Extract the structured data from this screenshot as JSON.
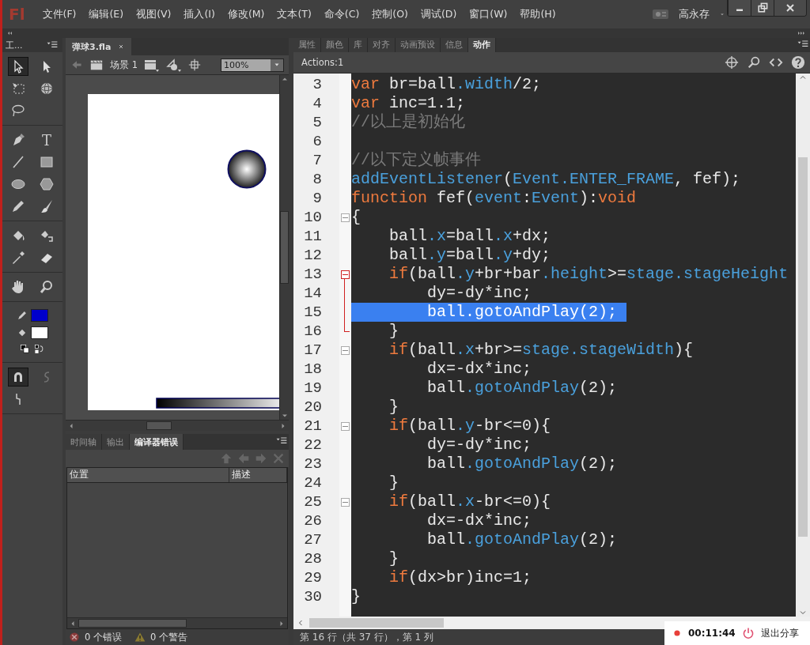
{
  "menu_bar": {
    "logo": "Fl",
    "menus": [
      "文件(F)",
      "编辑(E)",
      "视图(V)",
      "插入(I)",
      "修改(M)",
      "文本(T)",
      "命令(C)",
      "控制(O)",
      "调试(D)",
      "窗口(W)",
      "帮助(H)"
    ],
    "user": "高永存"
  },
  "tools_panel": {
    "title": "工...",
    "tool_groups": [
      {
        "tools": [
          {
            "selected": true
          },
          {
            "selected": false
          },
          {
            "selected": false
          },
          {
            "selected": false
          },
          {
            "selected": false
          }
        ]
      },
      {
        "tools": [
          {
            "selected": false
          },
          {
            "selected": false,
            "label": "T"
          },
          {
            "selected": false
          },
          {
            "selected": false
          },
          {
            "selected": false
          },
          {
            "selected": false
          },
          {
            "selected": false
          },
          {
            "selected": false
          }
        ]
      },
      {
        "tools": [
          {
            "selected": false
          },
          {
            "selected": false
          },
          {
            "selected": false
          },
          {
            "selected": false
          }
        ]
      },
      {
        "tools": [
          {
            "selected": false
          },
          {
            "selected": false
          }
        ]
      }
    ],
    "swatches": [
      {
        "color": "#0000cc"
      },
      {
        "color": "#ffffff"
      }
    ],
    "options": [
      {
        "selected": true,
        "disabled": false
      },
      {
        "selected": false,
        "disabled": true
      },
      {
        "selected": false,
        "disabled": false
      }
    ]
  },
  "document": {
    "tab": "弹球3.fla",
    "scene": "场景 1",
    "zoom": "100%"
  },
  "output_panel": {
    "tabs": [
      {
        "label": "时间轴",
        "selected": false
      },
      {
        "label": "输出",
        "selected": false
      },
      {
        "label": "编译器错误",
        "selected": true
      }
    ],
    "columns": [
      "位置",
      "描述"
    ],
    "errors": "0 个错误",
    "warnings": "0 个警告"
  },
  "actions_panel": {
    "tabs": [
      {
        "label": "属性",
        "selected": false
      },
      {
        "label": "颜色",
        "selected": false
      },
      {
        "label": "库",
        "selected": false
      },
      {
        "label": "对齐",
        "selected": false
      },
      {
        "label": "动画预设",
        "selected": false
      },
      {
        "label": "信息",
        "selected": false
      },
      {
        "label": "动作",
        "selected": true
      }
    ],
    "title": "Actions:1",
    "lines": [
      {
        "number": "3",
        "selected": false,
        "tokens": [
          {
            "kind": "kw",
            "text": "var"
          },
          {
            "kind": "plain",
            "text": " br=ball"
          },
          {
            "kind": "prop",
            "text": ".width"
          },
          {
            "kind": "plain",
            "text": "/2;"
          }
        ]
      },
      {
        "number": "4",
        "selected": false,
        "tokens": [
          {
            "kind": "kw",
            "text": "var"
          },
          {
            "kind": "plain",
            "text": " inc=1.1;"
          }
        ]
      },
      {
        "number": "5",
        "selected": false,
        "tokens": [
          {
            "kind": "comment",
            "text": "//以上是初始化"
          }
        ]
      },
      {
        "number": "6",
        "selected": false
      },
      {
        "number": "7",
        "selected": false,
        "tokens": [
          {
            "kind": "comment",
            "text": "//以下定义帧事件"
          }
        ]
      },
      {
        "number": "8",
        "selected": false,
        "tokens": [
          {
            "kind": "prop",
            "text": "addEventListener"
          },
          {
            "kind": "plain",
            "text": "("
          },
          {
            "kind": "prop",
            "text": "Event.ENTER_FRAME"
          },
          {
            "kind": "plain",
            "text": ", fef);"
          }
        ]
      },
      {
        "number": "9",
        "selected": false,
        "tokens": [
          {
            "kind": "kw",
            "text": "function"
          },
          {
            "kind": "plain",
            "text": " fef("
          },
          {
            "kind": "prop",
            "text": "event"
          },
          {
            "kind": "plain",
            "text": ":"
          },
          {
            "kind": "prop",
            "text": "Event"
          },
          {
            "kind": "plain",
            "text": "):"
          },
          {
            "kind": "kw",
            "text": "void"
          }
        ]
      },
      {
        "number": "10",
        "selected": false,
        "foldable": true,
        "tokens": [
          {
            "kind": "plain",
            "text": "{"
          }
        ]
      },
      {
        "number": "11",
        "selected": false,
        "tokens": [
          {
            "kind": "plain",
            "text": "    ball"
          },
          {
            "kind": "prop",
            "text": ".x"
          },
          {
            "kind": "plain",
            "text": "=ball"
          },
          {
            "kind": "prop",
            "text": ".x"
          },
          {
            "kind": "plain",
            "text": "+dx;"
          }
        ]
      },
      {
        "number": "12",
        "selected": false,
        "tokens": [
          {
            "kind": "plain",
            "text": "    ball"
          },
          {
            "kind": "prop",
            "text": ".y"
          },
          {
            "kind": "plain",
            "text": "=ball"
          },
          {
            "kind": "prop",
            "text": ".y"
          },
          {
            "kind": "plain",
            "text": "+dy;"
          }
        ]
      },
      {
        "number": "13",
        "selected": false,
        "foldable": true,
        "fold_highlight": true,
        "tokens": [
          {
            "kind": "kw",
            "text": "    if"
          },
          {
            "kind": "plain",
            "text": "(ball"
          },
          {
            "kind": "prop",
            "text": ".y"
          },
          {
            "kind": "plain",
            "text": "+br+bar"
          },
          {
            "kind": "prop",
            "text": ".height"
          },
          {
            "kind": "plain",
            "text": ">="
          },
          {
            "kind": "prop",
            "text": "stage.stageHeight"
          }
        ]
      },
      {
        "number": "14",
        "selected": false,
        "guide": true,
        "tokens": [
          {
            "kind": "plain",
            "text": "        dy=-dy*inc;"
          }
        ]
      },
      {
        "number": "15",
        "selected": true,
        "guide": true,
        "tokens": [
          {
            "kind": "plain",
            "text": "        ball.gotoAndPlay(2);"
          }
        ]
      },
      {
        "number": "16",
        "selected": false,
        "guide": true,
        "guide_end": true,
        "tokens": [
          {
            "kind": "plain",
            "text": "    }"
          }
        ]
      },
      {
        "number": "17",
        "selected": false,
        "foldable": true,
        "tokens": [
          {
            "kind": "kw",
            "text": "    if"
          },
          {
            "kind": "plain",
            "text": "(ball"
          },
          {
            "kind": "prop",
            "text": ".x"
          },
          {
            "kind": "plain",
            "text": "+br>="
          },
          {
            "kind": "prop",
            "text": "stage.stageWidth"
          },
          {
            "kind": "plain",
            "text": "){"
          }
        ]
      },
      {
        "number": "18",
        "selected": false,
        "tokens": [
          {
            "kind": "plain",
            "text": "        dx=-dx*inc;"
          }
        ]
      },
      {
        "number": "19",
        "selected": false,
        "tokens": [
          {
            "kind": "plain",
            "text": "        ball"
          },
          {
            "kind": "prop",
            "text": ".gotoAndPlay"
          },
          {
            "kind": "plain",
            "text": "(2);"
          }
        ]
      },
      {
        "number": "20",
        "selected": false,
        "tokens": [
          {
            "kind": "plain",
            "text": "    }"
          }
        ]
      },
      {
        "number": "21",
        "selected": false,
        "foldable": true,
        "tokens": [
          {
            "kind": "kw",
            "text": "    if"
          },
          {
            "kind": "plain",
            "text": "(ball"
          },
          {
            "kind": "prop",
            "text": ".y"
          },
          {
            "kind": "plain",
            "text": "-br<=0){"
          }
        ]
      },
      {
        "number": "22",
        "selected": false,
        "tokens": [
          {
            "kind": "plain",
            "text": "        dy=-dy*inc;"
          }
        ]
      },
      {
        "number": "23",
        "selected": false,
        "tokens": [
          {
            "kind": "plain",
            "text": "        ball"
          },
          {
            "kind": "prop",
            "text": ".gotoAndPlay"
          },
          {
            "kind": "plain",
            "text": "(2);"
          }
        ]
      },
      {
        "number": "24",
        "selected": false,
        "tokens": [
          {
            "kind": "plain",
            "text": "    }"
          }
        ]
      },
      {
        "number": "25",
        "selected": false,
        "foldable": true,
        "tokens": [
          {
            "kind": "kw",
            "text": "    if"
          },
          {
            "kind": "plain",
            "text": "(ball"
          },
          {
            "kind": "prop",
            "text": ".x"
          },
          {
            "kind": "plain",
            "text": "-br<=0){"
          }
        ]
      },
      {
        "number": "26",
        "selected": false,
        "tokens": [
          {
            "kind": "plain",
            "text": "        dx=-dx*inc;"
          }
        ]
      },
      {
        "number": "27",
        "selected": false,
        "tokens": [
          {
            "kind": "plain",
            "text": "        ball"
          },
          {
            "kind": "prop",
            "text": ".gotoAndPlay"
          },
          {
            "kind": "plain",
            "text": "(2);"
          }
        ]
      },
      {
        "number": "28",
        "selected": false,
        "tokens": [
          {
            "kind": "plain",
            "text": "    }"
          }
        ]
      },
      {
        "number": "29",
        "selected": false,
        "tokens": [
          {
            "kind": "kw",
            "text": "    if"
          },
          {
            "kind": "plain",
            "text": "(dx>br)inc=1;"
          }
        ]
      },
      {
        "number": "30",
        "selected": false,
        "tokens": [
          {
            "kind": "plain",
            "text": "}"
          }
        ]
      }
    ],
    "status": "第 16 行（共 37 行），第 1 列"
  },
  "recording": {
    "time": "00:11:44",
    "stop": "退出分享"
  }
}
